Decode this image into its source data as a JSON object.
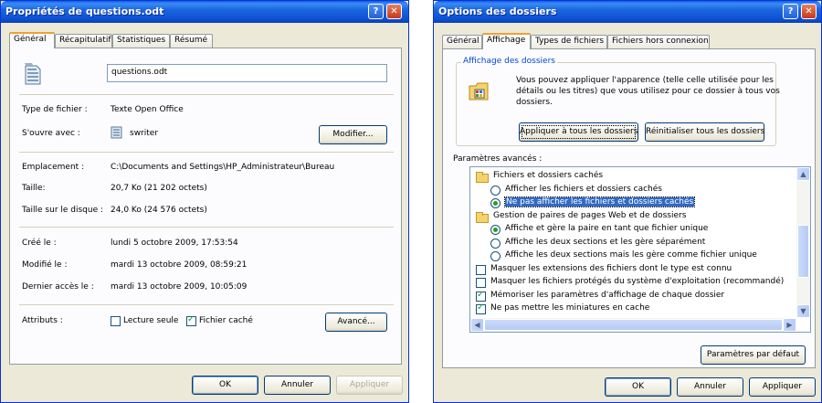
{
  "left_window": {
    "title": "Propriétés de questions.odt",
    "help_glyph": "?",
    "close_glyph": "✕",
    "tabs": [
      "Général",
      "Récapitulatif",
      "Statistiques",
      "Résumé"
    ],
    "filename": "questions.odt",
    "rows": {
      "type_label": "Type de fichier :",
      "type_value": "Texte Open Office",
      "opens_label": "S'ouvre avec :",
      "opens_value": "swriter",
      "modify_button": "Modifier...",
      "location_label": "Emplacement :",
      "location_value": "C:\\Documents and Settings\\HP_Administrateur\\Bureau",
      "size_label": "Taille:",
      "size_value": "20,7 Ko (21 202 octets)",
      "disk_label": "Taille sur le disque :",
      "disk_value": "24,0 Ko (24 576 octets)",
      "created_label": "Créé le :",
      "created_value": "lundi 5 octobre 2009, 17:53:54",
      "modified_label": "Modifié le :",
      "modified_value": "mardi 13 octobre 2009, 08:59:21",
      "accessed_label": "Dernier accès le :",
      "accessed_value": "mardi 13 octobre 2009, 10:05:09",
      "attributes_label": "Attributs :",
      "readonly_label": "Lecture seule",
      "readonly_checked": false,
      "hidden_label": "Fichier caché",
      "hidden_checked": true,
      "advanced_button": "Avancé..."
    },
    "buttons": {
      "ok": "OK",
      "cancel": "Annuler",
      "apply": "Appliquer"
    }
  },
  "right_window": {
    "title": "Options des dossiers",
    "help_glyph": "?",
    "close_glyph": "✕",
    "tabs": [
      "Général",
      "Affichage",
      "Types de fichiers",
      "Fichiers hors connexion"
    ],
    "group_title": "Affichage des dossiers",
    "group_text": "Vous pouvez appliquer l'apparence (telle celle utilisée pour les détails ou les titres) que vous utilisez pour ce dossier à tous vos dossiers.",
    "apply_all_button": "Appliquer à tous les dossiers",
    "reset_all_button": "Réinitialiser tous les dossiers",
    "advanced_label": "Paramètres avancés :",
    "tree": [
      {
        "kind": "folder",
        "label": "Fichiers et dossiers cachés"
      },
      {
        "kind": "radio",
        "checked": false,
        "label": "Afficher les fichiers et dossiers cachés"
      },
      {
        "kind": "radio",
        "checked": true,
        "selected": true,
        "label": "Ne pas afficher les fichiers et dossiers cachés"
      },
      {
        "kind": "folder",
        "label": "Gestion de paires de pages Web et de dossiers"
      },
      {
        "kind": "radio",
        "checked": true,
        "label": "Affiche et gère la paire en tant que fichier unique"
      },
      {
        "kind": "radio",
        "checked": false,
        "label": "Affiche les deux sections et les gère séparément"
      },
      {
        "kind": "radio",
        "checked": false,
        "label": "Affiche les deux sections mais les gère comme fichier unique"
      },
      {
        "kind": "check",
        "checked": false,
        "label": "Masquer les extensions des fichiers dont le type est connu"
      },
      {
        "kind": "check",
        "checked": false,
        "label": "Masquer les fichiers protégés du système d'exploitation (recommandé)"
      },
      {
        "kind": "check",
        "checked": true,
        "label": "Mémoriser les paramètres d'affichage de chaque dossier"
      },
      {
        "kind": "check",
        "checked": true,
        "label": "Ne pas mettre les miniatures en cache"
      }
    ],
    "defaults_button": "Paramètres par défaut",
    "buttons": {
      "ok": "OK",
      "cancel": "Annuler",
      "apply": "Appliquer"
    },
    "scroll_up_glyph": "▲",
    "scroll_down_glyph": "▼",
    "scroll_left_glyph": "◀",
    "scroll_right_glyph": "▶"
  }
}
